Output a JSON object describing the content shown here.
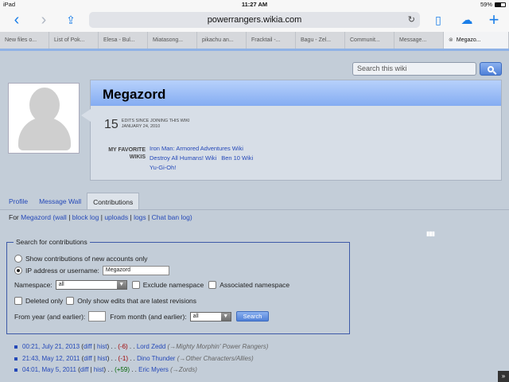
{
  "status": {
    "device": "iPad",
    "time": "11:27 AM",
    "battery": "59%"
  },
  "browser": {
    "url": "powerrangers.wikia.com",
    "tabs": [
      "New files o...",
      "List of Pok...",
      "Elesa - Bul...",
      "Miatasong...",
      "pikachu an...",
      "Fracktail -...",
      "Bagu - Zel...",
      "Communit...",
      "Message...",
      "Megazo..."
    ]
  },
  "wiki": {
    "search_placeholder": "Search this wiki",
    "username": "Megazord",
    "edit_count": "15",
    "edits_label": "EDITS SINCE JOINING THIS WIKI",
    "joined": "JANUARY 24, 2010",
    "fav_label": "MY FAVORITE WIKIS",
    "favorites": [
      "Iron Man: Armored Adventures Wiki",
      "Destroy All Humans! Wiki",
      "Ben 10 Wiki",
      "Yu-Gi-Oh!"
    ],
    "subtabs": [
      "Profile",
      "Message Wall",
      "Contributions"
    ],
    "for_line": {
      "prefix": "For",
      "user": "Megazord",
      "open": "(",
      "links": [
        "wall",
        "block log",
        "uploads",
        "logs",
        "Chat ban log"
      ],
      "sep": "|",
      "close": ")"
    },
    "form": {
      "legend": "Search for contributions",
      "radio_new": "Show contributions of new accounts only",
      "radio_ip": "IP address or username:",
      "ip_value": "Megazord",
      "namespace_label": "Namespace:",
      "namespace_value": "all",
      "exclude_ns": "Exclude namespace",
      "assoc_ns": "Associated namespace",
      "deleted_only": "Deleted only",
      "latest_only": "Only show edits that are latest revisions",
      "from_year": "From year (and earlier):",
      "from_month": "From month (and earlier):",
      "month_value": "all",
      "search_btn": "Search"
    },
    "results": [
      {
        "time": "00:21, July 21, 2013",
        "diff": "diff",
        "hist": "hist",
        "delta": "(-6)",
        "sign": "neg",
        "page": "Lord Zedd",
        "summary": "(→Mighty Morphin' Power Rangers)"
      },
      {
        "time": "21:43, May 12, 2011",
        "diff": "diff",
        "hist": "hist",
        "delta": "(-1)",
        "sign": "neg",
        "page": "Dino Thunder",
        "summary": "(→Other Characters/Allies)"
      },
      {
        "time": "04:01, May 5, 2011",
        "diff": "diff",
        "hist": "hist",
        "delta": "(+59)",
        "sign": "pos",
        "page": "Eric Myers",
        "summary": "(→Zords)"
      }
    ]
  }
}
